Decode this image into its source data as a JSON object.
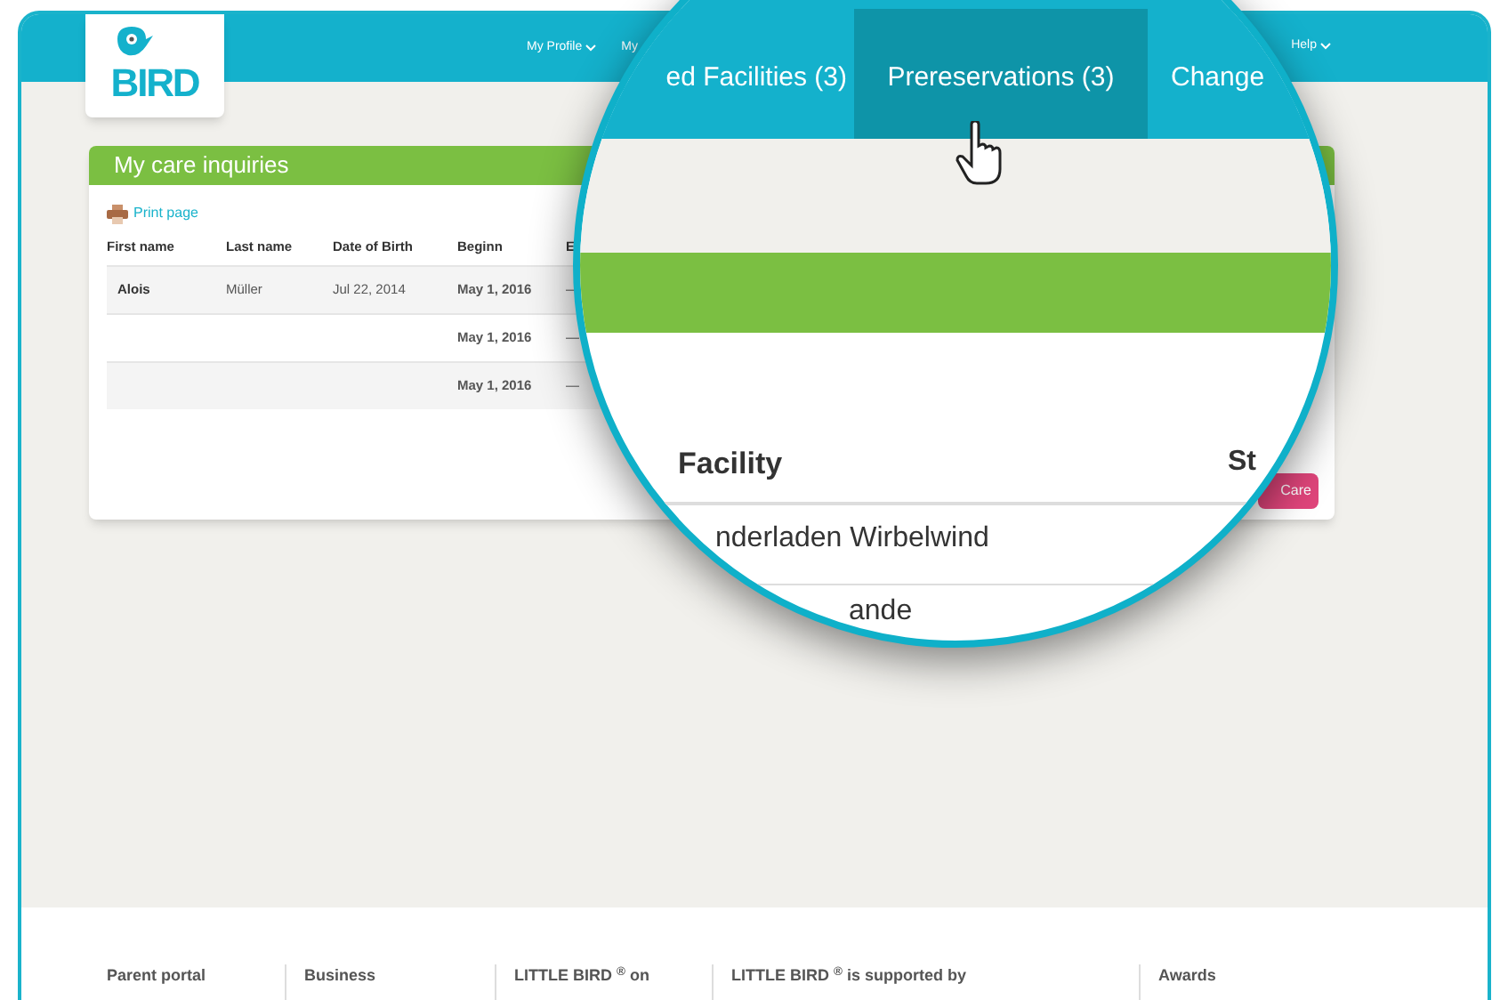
{
  "header": {
    "logo_text": "BIRD",
    "nav": [
      {
        "label": "My Profile",
        "dropdown": true
      },
      {
        "label": "My",
        "dropdown": false
      }
    ],
    "help": {
      "label": "Help",
      "dropdown": true
    }
  },
  "card": {
    "title": "My care inquiries",
    "print_link": "Print page",
    "columns": [
      "First name",
      "Last name",
      "Date of Birth",
      "Beginn",
      "E"
    ],
    "rows": [
      {
        "first_name": "Alois",
        "last_name": "Müller",
        "date_of_birth": "Jul 22, 2014",
        "beginn": "May 1, 2016",
        "column_5": "—"
      },
      {
        "beginn": "May 1, 2016",
        "column_5": "—"
      },
      {
        "beginn": "May 1, 2016",
        "column_5": "—"
      }
    ],
    "button": "Care"
  },
  "magnifier": {
    "tabs": [
      {
        "label": "ed Facilities (3)",
        "selected": false
      },
      {
        "label": "Prereservations (3)",
        "selected": true
      },
      {
        "label": "Change",
        "selected": false
      }
    ],
    "columns": [
      "Facility",
      "St"
    ],
    "rows": [
      "nderladen Wirbelwind",
      "ande"
    ]
  },
  "footer": {
    "columns": [
      "Parent portal",
      "Business",
      "LITTLE BIRD $^{®}$ on",
      "LITTLE BIRD $^{®}$ is supported by",
      "Awards"
    ]
  }
}
